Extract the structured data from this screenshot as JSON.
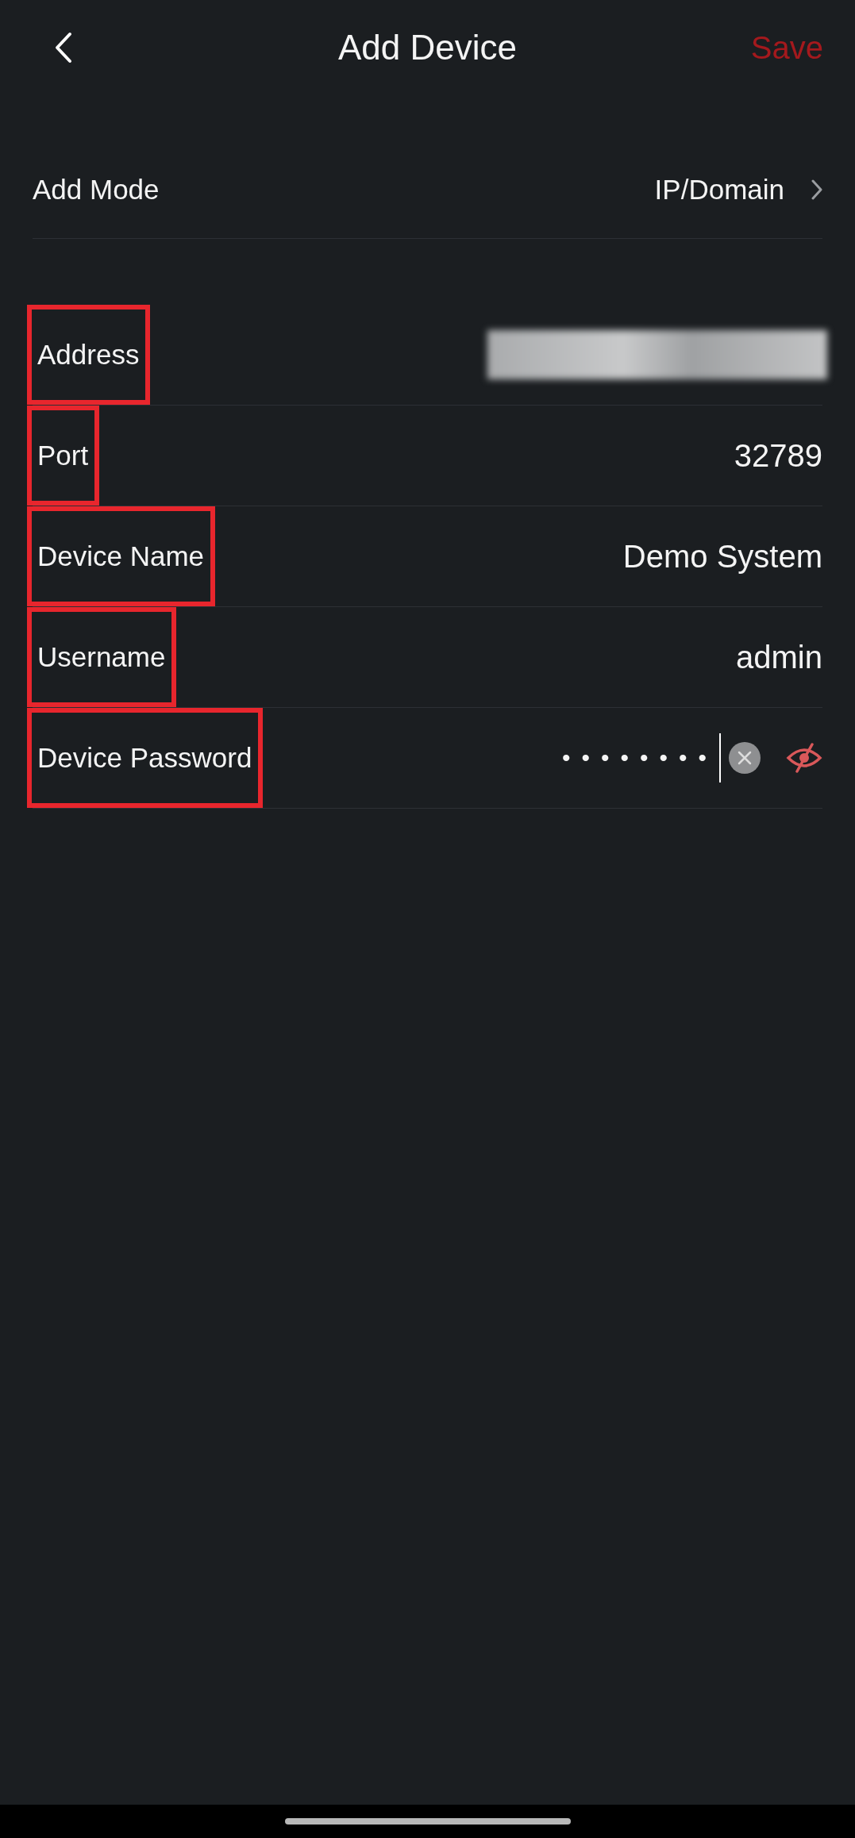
{
  "header": {
    "title": "Add Device",
    "action": "Save"
  },
  "add_mode": {
    "label": "Add Mode",
    "value": "IP/Domain"
  },
  "fields": [
    {
      "kind": "redacted",
      "label": "Address",
      "highlighted": true
    },
    {
      "kind": "text",
      "label": "Port",
      "value": "32789",
      "highlighted": true
    },
    {
      "kind": "text",
      "label": "Device Name",
      "value": "Demo System",
      "highlighted": true
    },
    {
      "kind": "text",
      "label": "Username",
      "value": "admin",
      "highlighted": true
    },
    {
      "kind": "password",
      "label": "Device Password",
      "value": "••••••••",
      "focused": true,
      "masked": true,
      "highlighted": true
    }
  ]
}
